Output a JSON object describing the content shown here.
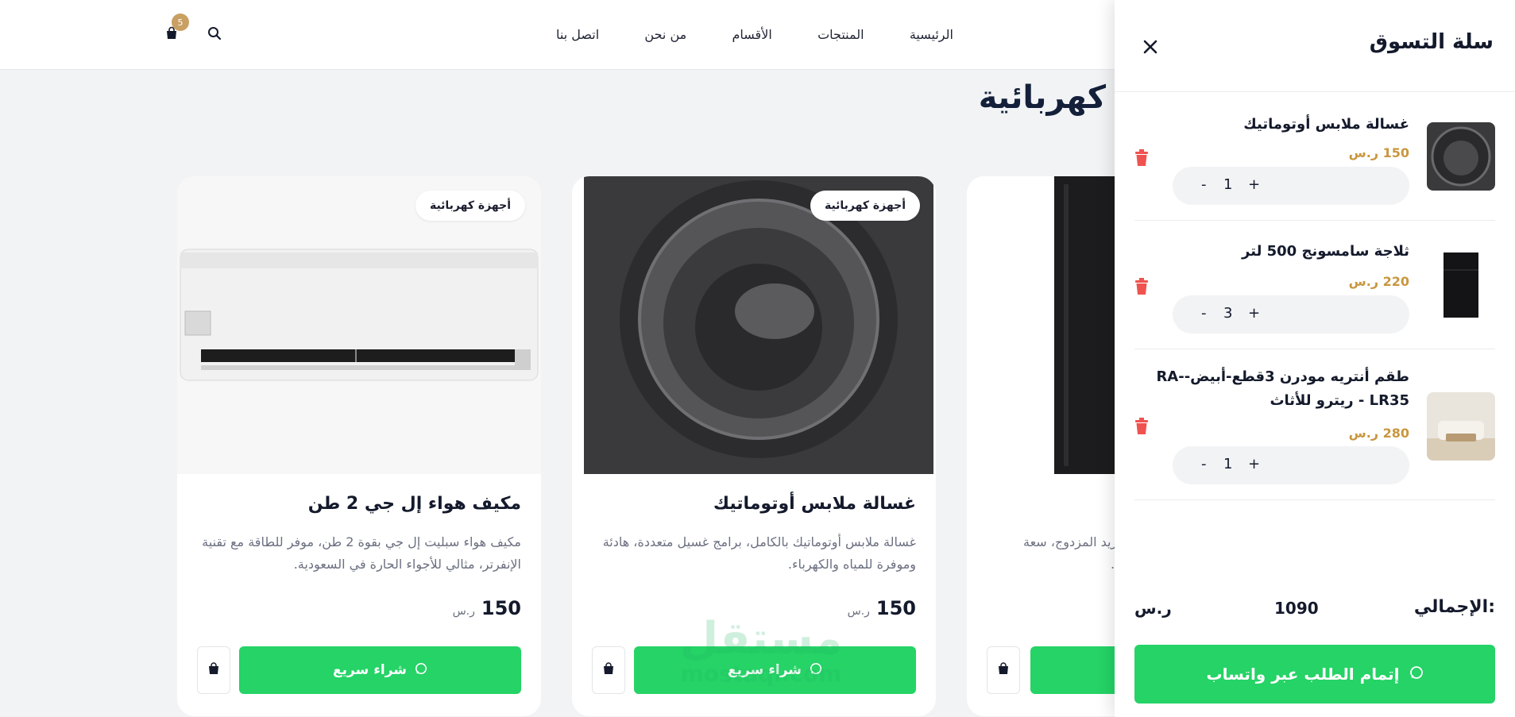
{
  "header": {
    "nav": [
      "الرئيسية",
      "المنتجات",
      "الأقسام",
      "من نحن",
      "اتصل بنا"
    ],
    "cart_count": "5"
  },
  "section_title": "كهربائية",
  "products": [
    {
      "category": "أجهزة كهربائية",
      "title": "مكيف هواء إل جي 2 طن",
      "description": "مكيف هواء سبليت إل جي بقوة 2 طن، موفر للطاقة مع تقنية الإنفرتر، مثالي للأجواء الحارة في السعودية.",
      "price": "150",
      "currency": "ر.س",
      "buy_label": "شراء سريع"
    },
    {
      "category": "أجهزة كهربائية",
      "title": "غسالة ملابس أوتوماتيك",
      "description": "غسالة ملابس أوتوماتيك بالكامل، برامج غسيل متعددة، هادئة وموفرة للمياه والكهرباء.",
      "price": "150",
      "currency": "ر.س",
      "buy_label": "شراء سريع"
    },
    {
      "desc_partial_1": "التبريد المزدوج، سعة",
      "desc_partial_2": "طبخ."
    }
  ],
  "cart": {
    "title": "سلة التسوق",
    "items": [
      {
        "name": "غسالة ملابس أوتوماتيك",
        "price": "150 ر.س",
        "qty": "1"
      },
      {
        "name": "ثلاجة سامسونج 500 لتر",
        "price": "220 ر.س",
        "qty": "3"
      },
      {
        "name": "طقم أنتريه مودرن 3قطع-أبيض-RA-LR35 - ريترو للأثاث",
        "price": "280 ر.س",
        "qty": "1"
      }
    ],
    "total_label": "الإجمالي:",
    "total_value": "1090",
    "total_currency": "ر.س",
    "checkout_label": "إتمام الطلب عبر واتساب"
  },
  "watermark": {
    "arabic": "مستقل",
    "latin": "mostaql.com"
  },
  "colors": {
    "whatsapp_green": "#25d366",
    "gold": "#c9a063",
    "price_gold": "#c9973f",
    "trash_red": "#ef5350"
  }
}
